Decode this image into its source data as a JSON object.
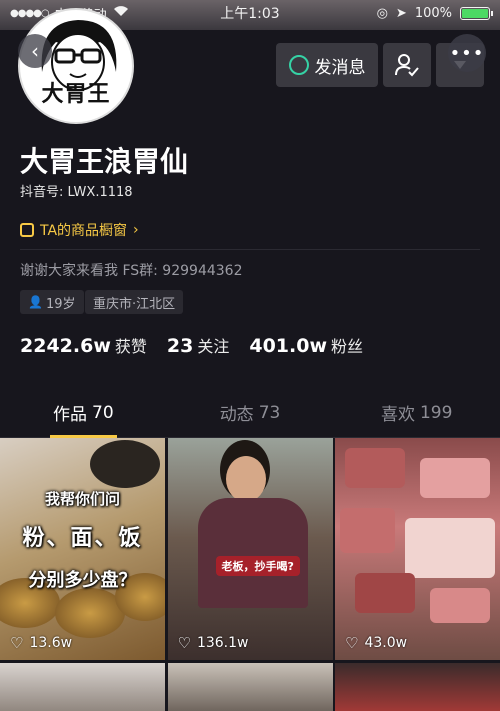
{
  "status_bar": {
    "carrier": "中国移动",
    "time": "上午1:03",
    "battery": "100%",
    "battery_level": 1.0
  },
  "avatar": {
    "text": "大胃王"
  },
  "actions": {
    "message_label": "发消息"
  },
  "profile": {
    "name": "大胃王浪胃仙",
    "douyin_id": "抖音号: LWX.1118",
    "shop_label": "TA的商品橱窗",
    "bio": "谢谢大家来看我 FS群: 929944362",
    "tags": {
      "age": "19岁",
      "city": "重庆市·江北区"
    }
  },
  "stats": [
    {
      "num": "2242.6w",
      "label": "获赞"
    },
    {
      "num": "23",
      "label": "关注"
    },
    {
      "num": "401.0w",
      "label": "粉丝"
    }
  ],
  "tabs": [
    {
      "label": "作品",
      "count": "70"
    },
    {
      "label": "动态",
      "count": "73"
    },
    {
      "label": "喜欢",
      "count": "199"
    }
  ],
  "videos": [
    {
      "likes": "13.6w",
      "lines": [
        "我帮你们问",
        "粉、面、饭",
        "分别多少盘？"
      ]
    },
    {
      "likes": "136.1w",
      "caption": "老板，抄手喝?"
    },
    {
      "likes": "43.0w"
    }
  ],
  "colors": {
    "accent": "#f7c945",
    "message_icon": "#35d2a5",
    "background": "#17161d"
  }
}
